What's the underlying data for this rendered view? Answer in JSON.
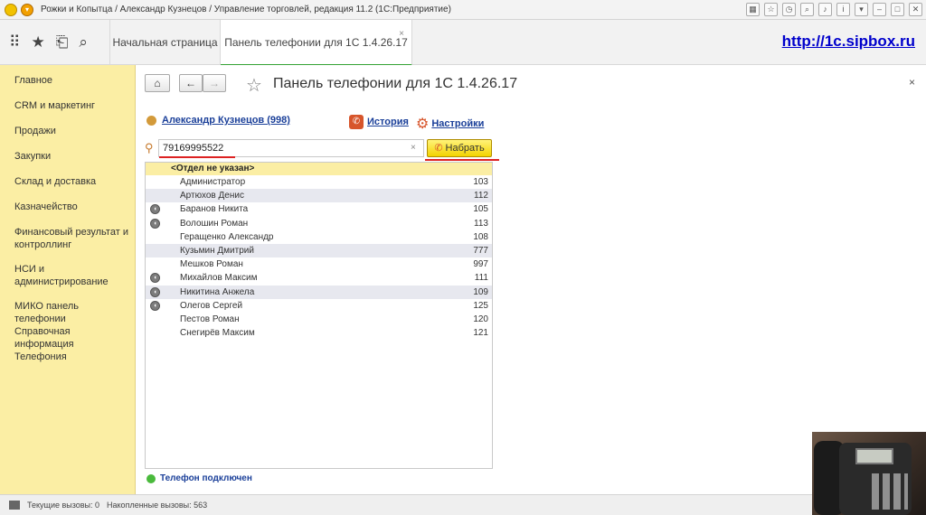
{
  "titlebar": {
    "title": "Рожки и Копытца / Александр Кузнецов / Управление торговлей, редакция 11.2  (1С:Предприятие)"
  },
  "tabs": {
    "home": "Начальная страница",
    "active": "Панель телефонии для 1С 1.4.26.17",
    "close": "×"
  },
  "site_link": "http://1c.sipbox.ru",
  "sidebar": {
    "items": [
      "Главное",
      "CRM и маркетинг",
      "Продажи",
      "Закупки",
      "Склад и доставка",
      "Казначейство",
      "Финансовый результат и контроллинг",
      "НСИ и администрирование",
      "МИКО панель телефонии",
      "Справочная информация",
      "Телефония"
    ]
  },
  "form": {
    "title": "Панель телефонии для 1С 1.4.26.17",
    "close": "×",
    "user_link": "Александр Кузнецов (998)",
    "history_link": "История",
    "settings_link": "Настройки",
    "search_value": "79169995522",
    "dial_label": "Набрать",
    "group_label": "<Отдел не указан>",
    "contacts": [
      {
        "name": "Администратор",
        "ext": "103",
        "online": false
      },
      {
        "name": "Артюхов Денис",
        "ext": "112",
        "online": false
      },
      {
        "name": "Баранов Никита",
        "ext": "105",
        "online": true
      },
      {
        "name": "Волошин Роман",
        "ext": "113",
        "online": true
      },
      {
        "name": "Геращенко Александр",
        "ext": "108",
        "online": false
      },
      {
        "name": "Кузьмин Дмитрий",
        "ext": "777",
        "online": false
      },
      {
        "name": "Мешков Роман",
        "ext": "997",
        "online": false
      },
      {
        "name": "Михайлов Максим",
        "ext": "111",
        "online": true
      },
      {
        "name": "Никитина Анжела",
        "ext": "109",
        "online": true
      },
      {
        "name": "Олегов Сергей",
        "ext": "125",
        "online": true
      },
      {
        "name": "Пестов Роман",
        "ext": "120",
        "online": false
      },
      {
        "name": "Снегирёв Максим",
        "ext": "121",
        "online": false
      }
    ],
    "status": "Телефон подключен"
  },
  "bottombar": {
    "current_calls": "Текущие вызовы: 0",
    "accumulated_calls": "Накопленные вызовы: 563"
  },
  "colors": {
    "sidebar_bg": "#fbeea4",
    "accent_green": "#35a235",
    "link_blue": "#1a3f99",
    "dial_button": "#f3d300"
  }
}
